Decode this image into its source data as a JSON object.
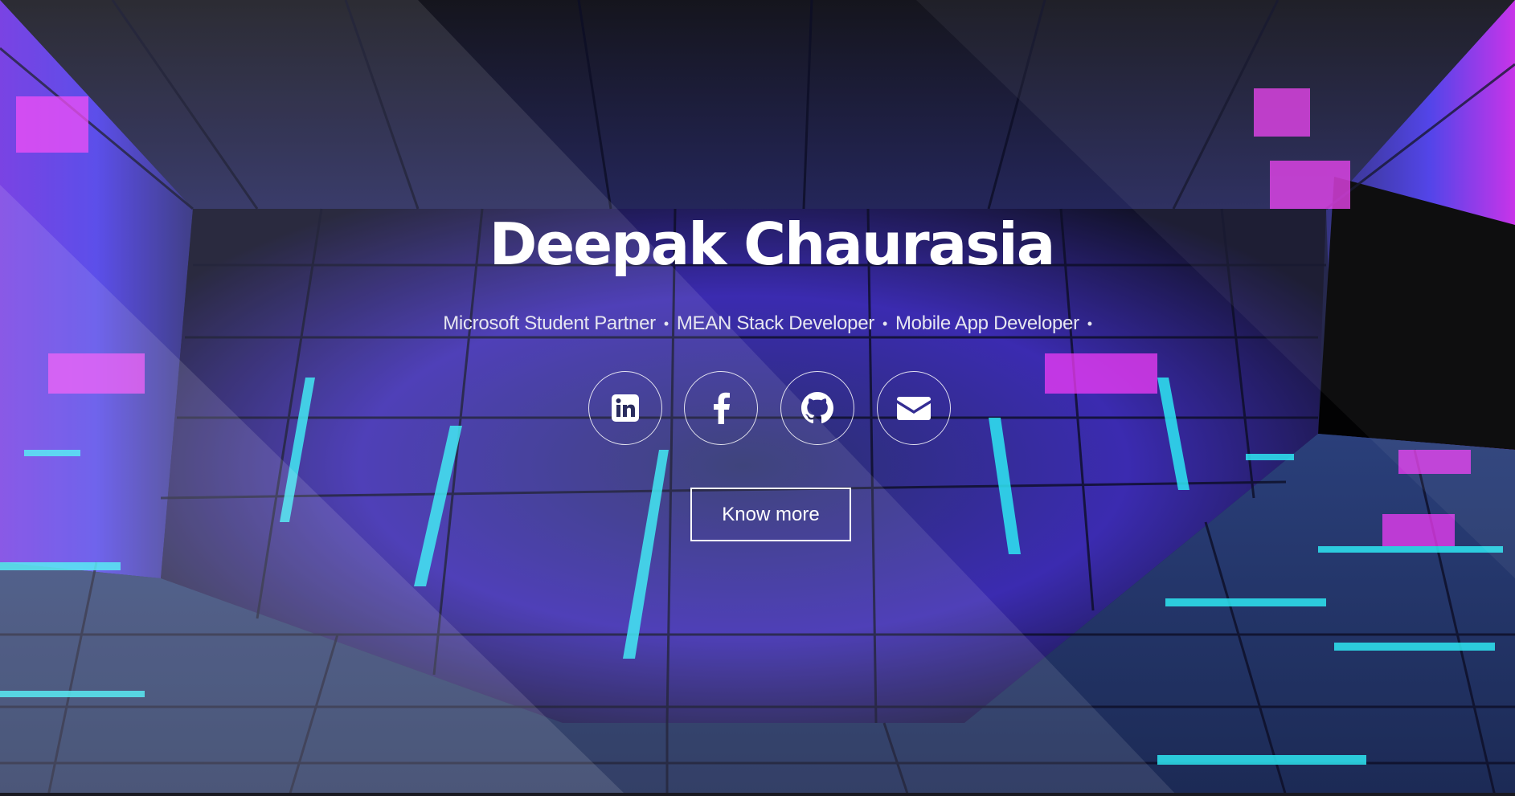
{
  "hero": {
    "name": "Deepak Chaurasia",
    "roles": [
      "Microsoft Student Partner",
      "MEAN Stack Developer",
      "Mobile App Developer"
    ],
    "separator": "•",
    "socials": [
      {
        "icon": "linkedin-icon"
      },
      {
        "icon": "facebook-icon"
      },
      {
        "icon": "github-icon"
      },
      {
        "icon": "envelope-icon"
      }
    ],
    "cta_label": "Know more"
  },
  "colors": {
    "text": "#ffffff",
    "accent_cyan": "#2ee6f2",
    "accent_magenta": "#e23cf0",
    "accent_violet": "#5a3cf0"
  }
}
